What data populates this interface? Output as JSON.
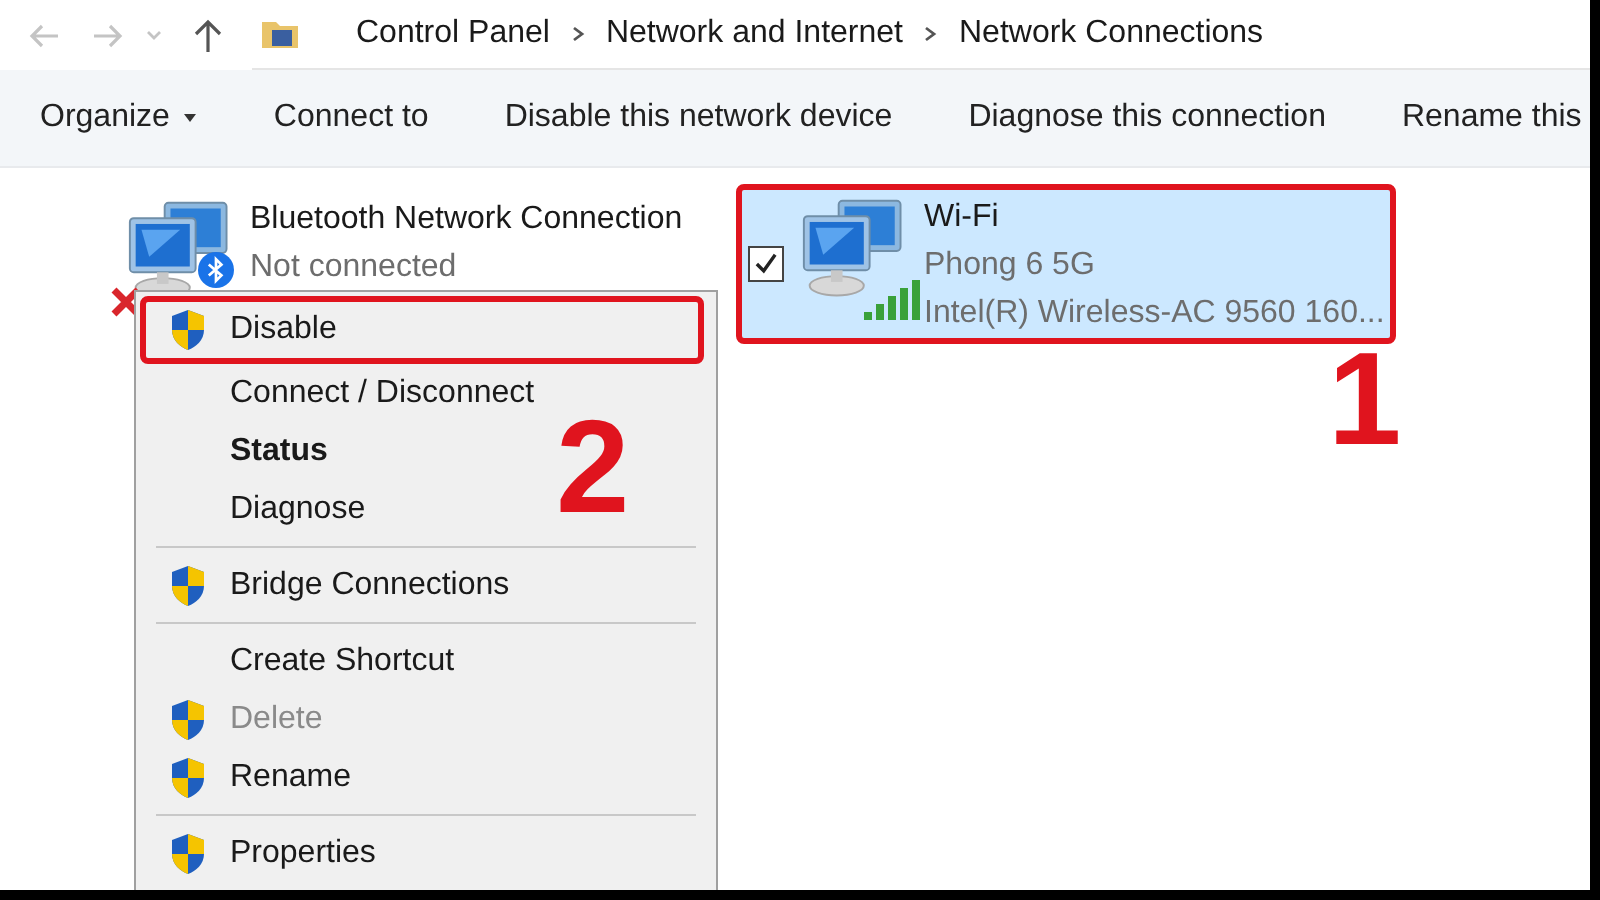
{
  "address_bar": {
    "breadcrumbs": [
      "Control Panel",
      "Network and Internet",
      "Network Connections"
    ]
  },
  "toolbar": [
    {
      "label": "Organize",
      "dropdown": true
    },
    {
      "label": "Connect to",
      "dropdown": false
    },
    {
      "label": "Disable this network device",
      "dropdown": false
    },
    {
      "label": "Diagnose this connection",
      "dropdown": false
    },
    {
      "label": "Rename this",
      "dropdown": false
    }
  ],
  "connections": [
    {
      "name": "Bluetooth Network Connection",
      "status": "Not connected",
      "kind": "bluetooth",
      "selected": false,
      "highlighted": false
    },
    {
      "name": "Wi-Fi",
      "status": "Phong 6 5G",
      "device": "Intel(R) Wireless-AC 9560 160...",
      "kind": "wifi",
      "selected": true,
      "highlighted": true
    }
  ],
  "context_menu": [
    {
      "kind": "item",
      "label": "Disable",
      "shield": true,
      "bold": false,
      "disabled": false,
      "highlighted": true
    },
    {
      "kind": "item",
      "label": "Connect / Disconnect",
      "shield": false,
      "bold": false,
      "disabled": false,
      "highlighted": false
    },
    {
      "kind": "item",
      "label": "Status",
      "shield": false,
      "bold": true,
      "disabled": false,
      "highlighted": false
    },
    {
      "kind": "item",
      "label": "Diagnose",
      "shield": false,
      "bold": false,
      "disabled": false,
      "highlighted": false
    },
    {
      "kind": "separator"
    },
    {
      "kind": "item",
      "label": "Bridge Connections",
      "shield": true,
      "bold": false,
      "disabled": false,
      "highlighted": false
    },
    {
      "kind": "separator"
    },
    {
      "kind": "item",
      "label": "Create Shortcut",
      "shield": false,
      "bold": false,
      "disabled": false,
      "highlighted": false
    },
    {
      "kind": "item",
      "label": "Delete",
      "shield": true,
      "bold": false,
      "disabled": true,
      "highlighted": false
    },
    {
      "kind": "item",
      "label": "Rename",
      "shield": true,
      "bold": false,
      "disabled": false,
      "highlighted": false
    },
    {
      "kind": "separator"
    },
    {
      "kind": "item",
      "label": "Properties",
      "shield": true,
      "bold": false,
      "disabled": false,
      "highlighted": false
    }
  ],
  "step_numbers": [
    "1",
    "2"
  ]
}
